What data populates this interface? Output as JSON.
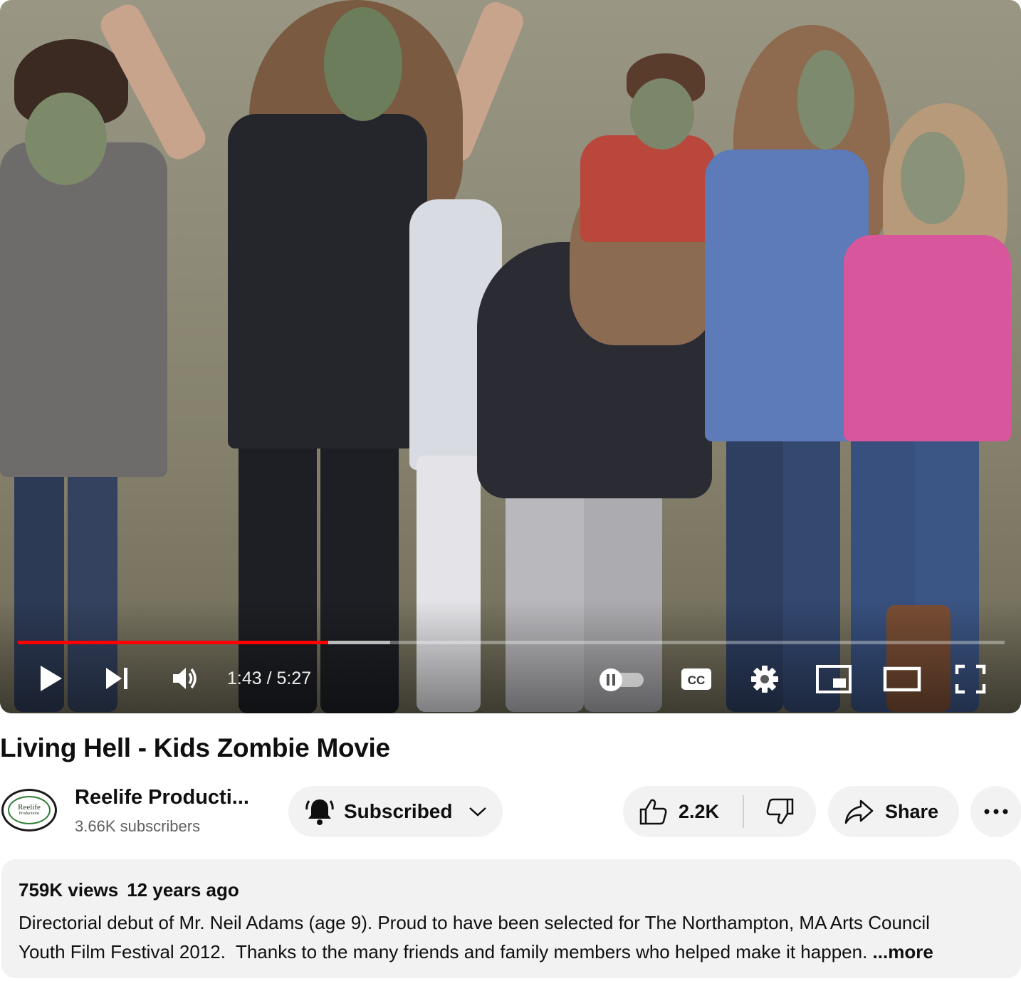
{
  "player": {
    "current_time": "1:43",
    "separator": " / ",
    "duration": "5:27",
    "progress_fraction": 0.3145,
    "buffered_fraction": 0.377,
    "progress_color": "#ff0000",
    "controls": {
      "play": "play-icon",
      "next": "next-icon",
      "volume": "volume-icon",
      "autoplay": "autoplay-toggle-icon",
      "captions": "CC",
      "settings": "gear-icon",
      "miniplayer": "miniplayer-icon",
      "theater": "theater-mode-icon",
      "fullscreen": "fullscreen-icon"
    }
  },
  "video": {
    "title": "Living Hell - Kids Zombie Movie"
  },
  "channel": {
    "name": "Reelife Producti...",
    "subscribers": "3.66K subscribers",
    "avatar_text": "Reelife",
    "avatar_subtext": "Productions"
  },
  "actions": {
    "subscribe_label": "Subscribed",
    "like_count": "2.2K",
    "share_label": "Share",
    "more_icon": "more-horizontal-icon"
  },
  "description": {
    "views": "759K views",
    "age": "12 years ago",
    "text": "Directorial debut of Mr. Neil Adams (age 9). Proud to have been selected for The Northampton, MA Arts Council\nYouth Film Festival 2012.  Thanks to the many friends and family members who helped make it happen. ",
    "more_label": "...more"
  }
}
